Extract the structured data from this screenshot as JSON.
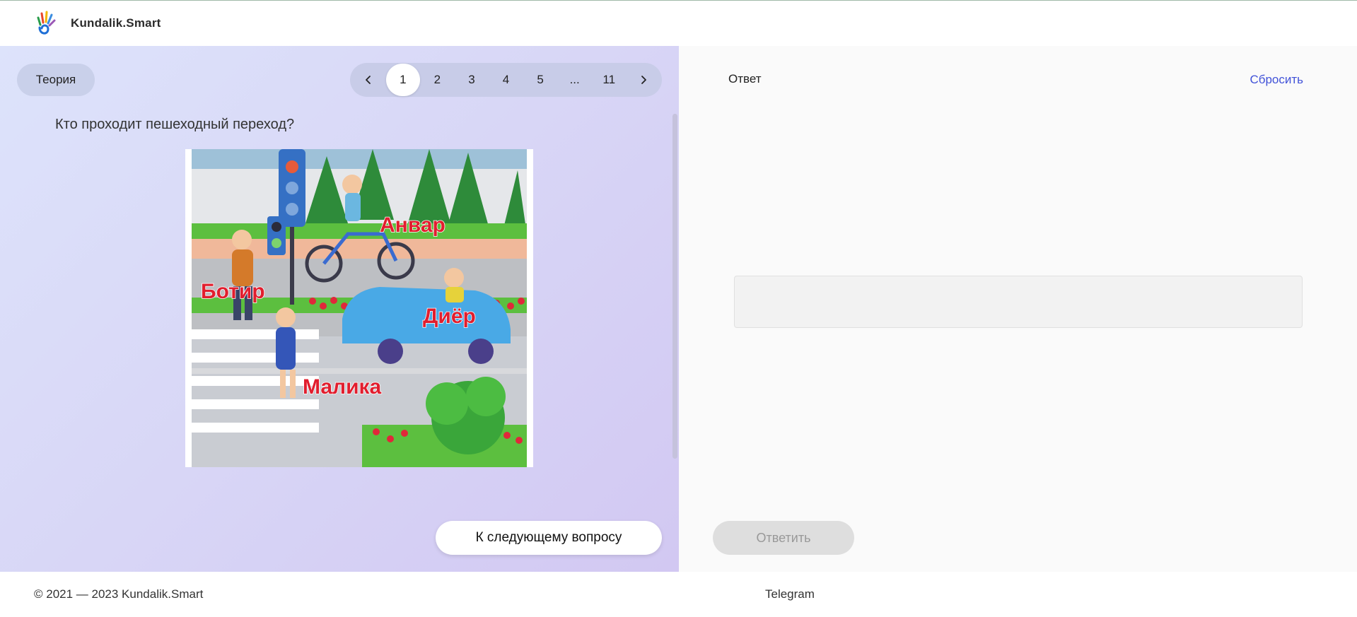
{
  "header": {
    "brand": "Kundalik.Smart",
    "logo_icon": "hand-logo-icon"
  },
  "left": {
    "theory_label": "Теория",
    "pager": {
      "pages": [
        "1",
        "2",
        "3",
        "4",
        "5",
        "...",
        "11"
      ],
      "active": "1",
      "prev_icon": "chevron-left-icon",
      "next_icon": "chevron-right-icon"
    },
    "question": "Кто проходит пешеходный переход?",
    "picture": {
      "labels": [
        "Анвар",
        "Ботир",
        "Диёр",
        "Малика"
      ]
    },
    "next_label": "К следующему вопросу"
  },
  "right": {
    "answer_label": "Ответ",
    "reset_label": "Сбросить",
    "answer_value": "",
    "submit_label": "Ответить"
  },
  "footer": {
    "copyright": "© 2021 — 2023 Kundalik.Smart",
    "telegram": "Telegram"
  },
  "colors": {
    "accent_link": "#4152d8",
    "panel_gradient_start": "#dde3fb",
    "panel_gradient_end": "#d2c8f2",
    "disabled_button": "#dedede"
  }
}
